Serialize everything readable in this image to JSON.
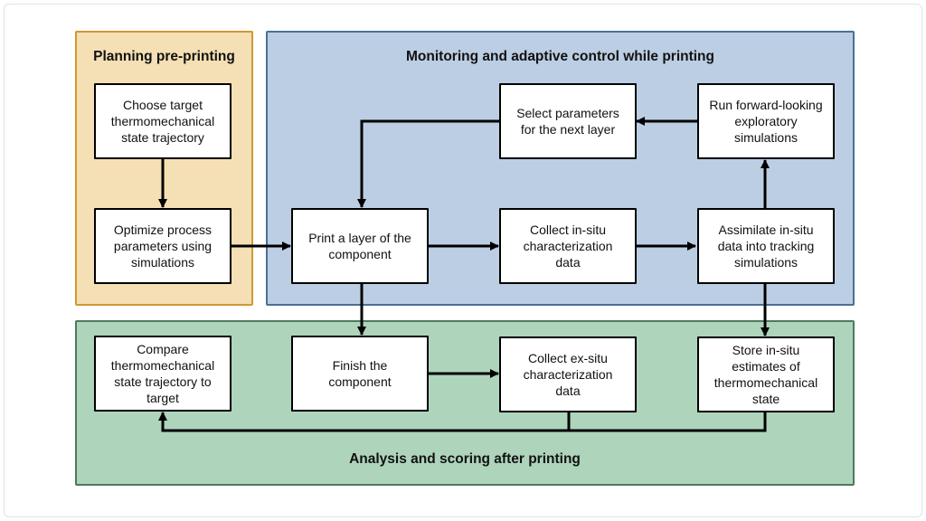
{
  "colors": {
    "planning_fill": "#f5dfb4",
    "planning_border": "#cf9a31",
    "monitoring_fill": "#bccee3",
    "monitoring_border": "#4b6f98",
    "analysis_fill": "#aed4bc",
    "analysis_border": "#4e7a5d"
  },
  "panels": {
    "planning": "Planning pre-printing",
    "monitoring": "Monitoring and adaptive control while printing",
    "analysis": "Analysis and scoring after printing"
  },
  "boxes": {
    "choose_target": "Choose target\nthermomechanical\nstate trajectory",
    "optimize": "Optimize process\nparameters using\nsimulations",
    "print_layer": "Print a layer of the\ncomponent",
    "collect_in_situ": "Collect in-situ\ncharacterization\ndata",
    "assimilate": "Assimilate in-situ\ndata into tracking\nsimulations",
    "select_params": "Select parameters\nfor the next layer",
    "run_forward": "Run forward-looking\nexploratory\nsimulations",
    "compare": "Compare\nthermomechanical\nstate trajectory to\ntarget",
    "finish": "Finish the\ncomponent",
    "collect_ex_situ": "Collect ex-situ\ncharacterization\ndata",
    "store": "Store in-situ\nestimates of\nthermomechanical\nstate"
  }
}
